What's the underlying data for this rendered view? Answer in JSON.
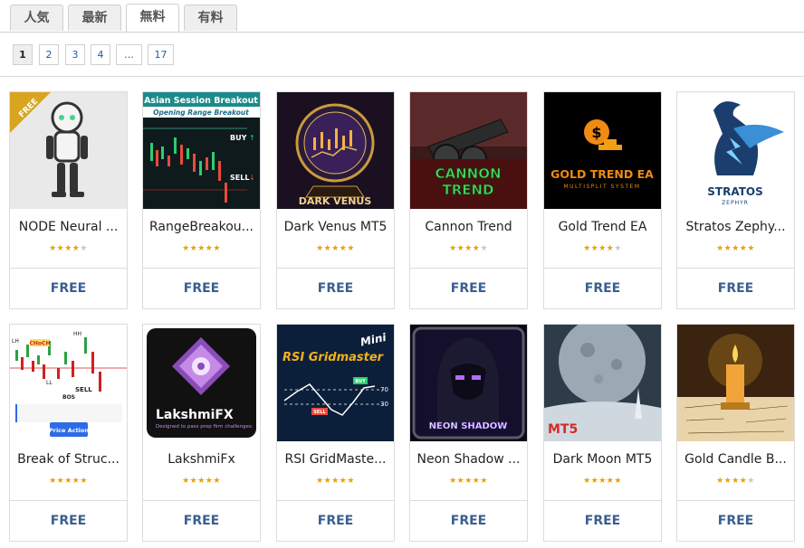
{
  "tabs": [
    {
      "label": "人気"
    },
    {
      "label": "最新"
    },
    {
      "label": "無料",
      "active": true
    },
    {
      "label": "有料"
    }
  ],
  "pagination": {
    "pages": [
      "1",
      "2",
      "3",
      "4",
      "…",
      "17"
    ],
    "current": "1"
  },
  "products": [
    {
      "name": "NODE Neural ...",
      "rating": 4,
      "price": "FREE",
      "thumb_text": "FREE",
      "thumb_colors": [
        "#e9e9e9",
        "#2c2c2c"
      ]
    },
    {
      "name": "RangeBreakou...",
      "rating": 4.5,
      "price": "FREE",
      "thumb_text": "Asian Session Breakout",
      "thumb_sub": "Opening Range Breakout",
      "thumb_labels": [
        "BUY",
        "SELL"
      ],
      "thumb_colors": [
        "#0d1b1e",
        "#2aa198"
      ]
    },
    {
      "name": "Dark Venus MT5",
      "rating": 4.5,
      "price": "FREE",
      "thumb_text": "DARK VENUS",
      "thumb_colors": [
        "#1a1020",
        "#c89b3c"
      ]
    },
    {
      "name": "Cannon Trend",
      "rating": 4,
      "price": "FREE",
      "thumb_text": "CANNON TREND",
      "thumb_colors": [
        "#3a1a1a",
        "#4cd65c"
      ]
    },
    {
      "name": "Gold Trend EA",
      "rating": 4,
      "price": "FREE",
      "thumb_text": "GOLD TREND EA",
      "thumb_sub": "MULTISPLIT SYSTEM",
      "thumb_colors": [
        "#000000",
        "#e88a12"
      ]
    },
    {
      "name": "Stratos Zephy...",
      "rating": 5,
      "price": "FREE",
      "thumb_text": "STRATOS",
      "thumb_sub": "ZEPHYR",
      "thumb_colors": [
        "#ffffff",
        "#1b3e6e"
      ]
    },
    {
      "name": "Break of Struc...",
      "rating": 4.5,
      "price": "FREE",
      "thumb_labels": [
        "CHoCH",
        "BOS",
        "SELL",
        "HH",
        "LH",
        "LL"
      ],
      "thumb_sub": "Price Action",
      "thumb_colors": [
        "#ffffff",
        "#d11f1f"
      ]
    },
    {
      "name": "LakshmiFx",
      "rating": 4.5,
      "price": "FREE",
      "thumb_text": "LakshmiFX",
      "thumb_sub": "Designed to pass prop firm challenges.",
      "thumb_colors": [
        "#111111",
        "#a070c8"
      ]
    },
    {
      "name": "RSI GridMaste...",
      "rating": 5,
      "price": "FREE",
      "thumb_text": "RSI Gridmaster",
      "thumb_badge": "Mini",
      "thumb_labels": [
        "BUY",
        "SELL",
        "70",
        "30"
      ],
      "thumb_colors": [
        "#0c1f3a",
        "#f2b01e"
      ]
    },
    {
      "name": "Neon Shadow ...",
      "rating": 4.5,
      "price": "FREE",
      "thumb_text": "NEON SHADOW",
      "thumb_colors": [
        "#140f2a",
        "#8a3ce0"
      ]
    },
    {
      "name": "Dark Moon MT5",
      "rating": 4.5,
      "price": "FREE",
      "thumb_text": "MT5",
      "thumb_colors": [
        "#2d3c48",
        "#cfd8de"
      ]
    },
    {
      "name": "Gold Candle B...",
      "rating": 4,
      "price": "FREE",
      "thumb_colors": [
        "#3a2410",
        "#f5a623"
      ]
    }
  ],
  "colors": {
    "star": "#e8a200",
    "price": "#3a5f8f",
    "link": "#1a5ea8"
  }
}
